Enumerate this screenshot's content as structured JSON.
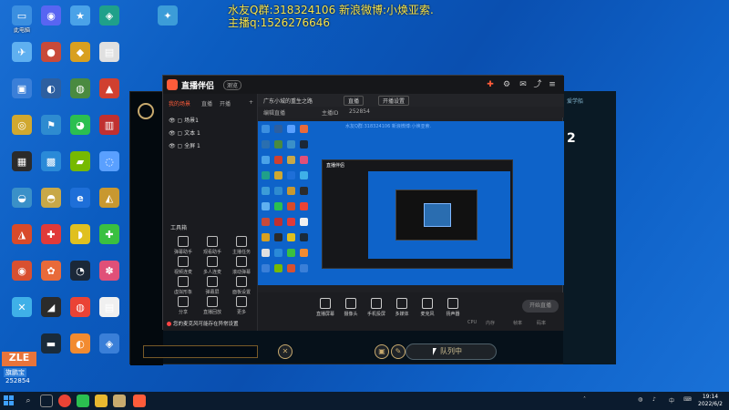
{
  "overlay": {
    "line1": "水友Q群:318324106 新浪微博:小焕亚索.",
    "line2": "主播q:1526276646"
  },
  "desktop_icons": [
    {
      "label": "此电脑",
      "color": "#3b8fe0",
      "glyph": "▭"
    },
    {
      "label": "",
      "color": "#2a6fb0",
      "glyph": "◉"
    },
    {
      "label": "",
      "color": "#4aa2e8",
      "glyph": "★"
    },
    {
      "label": "",
      "color": "#1fa08a",
      "glyph": "◈"
    },
    {
      "label": "",
      "color": "#3c9cd8",
      "glyph": "✦"
    },
    {
      "label": "",
      "color": "#5fb0f0",
      "glyph": "✈"
    },
    {
      "label": "",
      "color": "#c84a3a",
      "glyph": "●"
    },
    {
      "label": "",
      "color": "#d8a020",
      "glyph": "◆"
    },
    {
      "label": "",
      "color": "#e0e0e0",
      "glyph": "▤"
    },
    {
      "label": "",
      "color": "#3a7fd8",
      "glyph": "▣"
    },
    {
      "label": "",
      "color": "#2d5fa0",
      "glyph": "◐"
    },
    {
      "label": "",
      "color": "#4a8a40",
      "glyph": "◍"
    },
    {
      "label": "",
      "color": "#d04030",
      "glyph": "▲"
    },
    {
      "label": "",
      "color": "#d0a830",
      "glyph": "◎"
    },
    {
      "label": "",
      "color": "#2e8bd0",
      "glyph": "⚑"
    },
    {
      "label": "",
      "color": "#2bbf50",
      "glyph": "◕"
    },
    {
      "label": "",
      "color": "#c03030",
      "glyph": "▥"
    },
    {
      "label": "",
      "color": "#2b2b2b",
      "glyph": "▦"
    },
    {
      "label": "",
      "color": "#2a8ad8",
      "glyph": "▩"
    },
    {
      "label": "",
      "color": "#76b900",
      "glyph": "▰"
    },
    {
      "label": "",
      "color": "#5aa0ff",
      "glyph": "◌"
    },
    {
      "label": "",
      "color": "#3a90c8",
      "glyph": "◒"
    },
    {
      "label": "",
      "color": "#c8a848",
      "glyph": "◓"
    },
    {
      "label": "",
      "color": "#1e6fd8",
      "glyph": "e"
    },
    {
      "label": "",
      "color": "#c89830",
      "glyph": "◭"
    },
    {
      "label": "",
      "color": "#d84a2a",
      "glyph": "◮"
    },
    {
      "label": "",
      "color": "#e03a3a",
      "glyph": "✚"
    },
    {
      "label": "",
      "color": "#e0c020",
      "glyph": "◗"
    },
    {
      "label": "",
      "color": "#3ac040",
      "glyph": "✚"
    },
    {
      "label": "",
      "color": "#d85030",
      "glyph": "◉"
    },
    {
      "label": "",
      "color": "#e86a3a",
      "glyph": "✿"
    },
    {
      "label": "",
      "color": "#1b2838",
      "glyph": "◔"
    },
    {
      "label": "",
      "color": "#e05078",
      "glyph": "✽"
    },
    {
      "label": "",
      "color": "#3fb0e8",
      "glyph": "✕"
    },
    {
      "label": "",
      "color": "#2b2b2b",
      "glyph": "◢"
    },
    {
      "label": "",
      "color": "#ea4335",
      "glyph": "◍"
    },
    {
      "label": "",
      "color": "#f0f0f0",
      "glyph": "▤"
    },
    {
      "label": "",
      "color": "#1a2b3a",
      "glyph": "▬"
    },
    {
      "label": "",
      "color": "#f28b30",
      "glyph": "◐"
    },
    {
      "label": "",
      "color": "#3a7fd8",
      "glyph": "◈"
    },
    {
      "label": "",
      "color": "#5865f2",
      "glyph": "◉"
    }
  ],
  "app": {
    "title": "直播伴侣",
    "version": "测览",
    "tabs": [
      "我的场景",
      "直播",
      "开播",
      "+"
    ],
    "scenes": [
      "场景1",
      "文本 1",
      "全屏 1"
    ],
    "tools_title": "工具箱",
    "tools": [
      "弹幕助手",
      "观看助手",
      "主播任务",
      "视频连麦",
      "多人连麦",
      "滚动弹幕",
      "虚拟形象",
      "弹幕屏",
      "面板设置",
      "分享",
      "直播回放",
      "更多"
    ],
    "warning": "您的麦克风可能存在异常设置",
    "toolbar": {
      "stream_title": "广东小城的重生之路",
      "category": "直播",
      "scene_label": "编辑直播",
      "live_label": "开播设置",
      "room": "主播ID",
      "room_value": "252854"
    },
    "bottom_tools": [
      "直播屏幕",
      "摄像头",
      "手机投屏",
      "多媒体",
      "麦克风",
      "扬声器"
    ],
    "start_button": "开始直播",
    "stats": [
      "CPU",
      "内存",
      "帧率",
      "码率"
    ]
  },
  "game": {
    "queue_button": "队列中",
    "right_number": "2",
    "right_lines": [
      "爱学船",
      "",
      "",
      "",
      "",
      ""
    ]
  },
  "badge": {
    "big": "ZLE",
    "name": "旗鹏宝",
    "num": "252854"
  },
  "taskbar": {
    "time": "19:14",
    "date": "2022/6/2"
  },
  "colors": {
    "desktop": "#0b5cc0",
    "app_bg": "#1f2024",
    "accent": "#ff5c3a",
    "overlay_text": "#f7e34a"
  }
}
